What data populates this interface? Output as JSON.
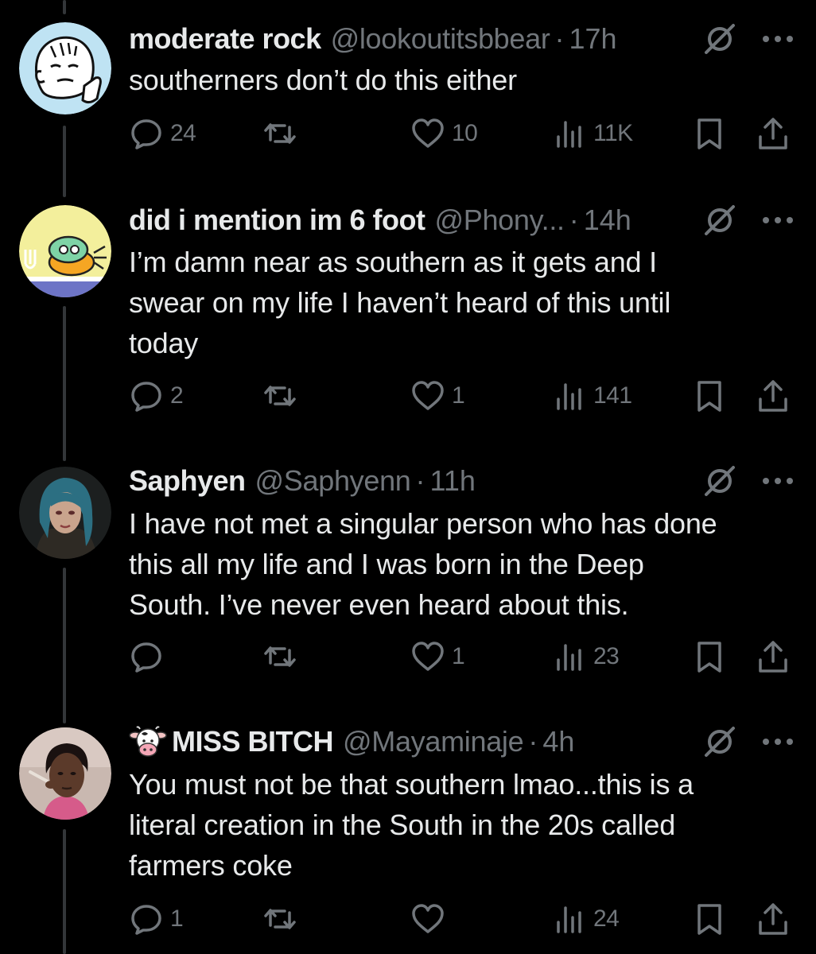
{
  "tweets": [
    {
      "display_name": "moderate rock",
      "handle": "@lookoutitsbbear",
      "time": "17h",
      "lines": [
        "southerners don’t do this either"
      ],
      "replies": "24",
      "retweets": "",
      "likes": "10",
      "views": "11K"
    },
    {
      "display_name": "did i mention im 6 foot",
      "handle": "@Phony...",
      "time": "14h",
      "lines": [
        "I’m damn near as southern as it gets and I",
        "swear on my life I haven’t heard of this until",
        "today"
      ],
      "replies": "2",
      "retweets": "",
      "likes": "1",
      "views": "141"
    },
    {
      "display_name": "Saphyen",
      "handle": "@Saphyenn",
      "time": "11h",
      "lines": [
        "I have not met a singular person who has done",
        "this all my life and I was born in the Deep",
        "South. I’ve never even heard about this."
      ],
      "replies": "",
      "retweets": "",
      "likes": "1",
      "views": "23"
    },
    {
      "display_name": "MISS BITCH",
      "handle": "@Mayaminaje",
      "time": "4h",
      "lines": [
        "You must not be that southern lmao...this is a",
        "literal creation in the South in the 20s called",
        "farmers coke"
      ],
      "replies": "1",
      "retweets": "",
      "likes": "",
      "views": "24"
    }
  ],
  "separator": "·",
  "icons": {
    "reply": "reply-icon",
    "retweet": "retweet-icon",
    "like": "heart-icon",
    "views": "views-icon",
    "bookmark": "bookmark-icon",
    "share": "share-icon",
    "grok": "grok-icon",
    "more": "more-icon"
  },
  "colors": {
    "background": "#000000",
    "primary_text": "#e7e9ea",
    "secondary_text": "#71767b",
    "thread_line": "#333639"
  }
}
